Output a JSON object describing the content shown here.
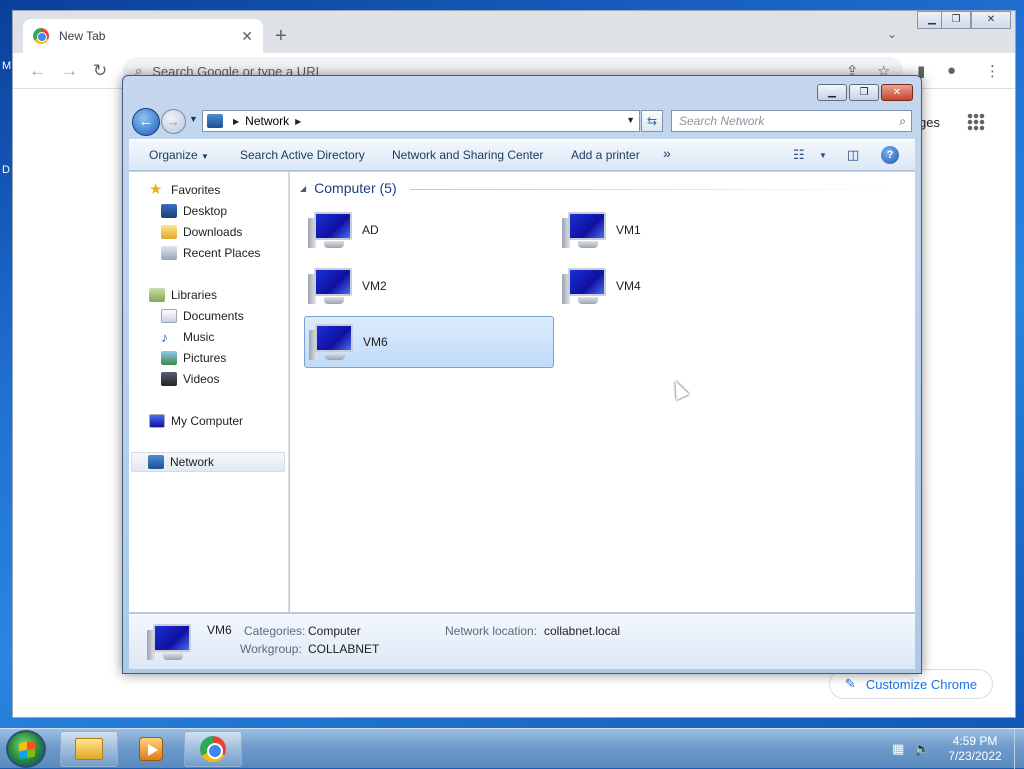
{
  "desktop": {
    "edge_letter_1": "M",
    "edge_letter_2": "D"
  },
  "chrome": {
    "tab_title": "New Tab",
    "tab_close": "✕",
    "new_tab": "+",
    "tab_menu": "⌄",
    "omnibox_placeholder": "Search Google or type a URL",
    "ntp_link": "ges",
    "customize_label": "Customize Chrome",
    "win_minimize": "▁",
    "win_restore": "❐",
    "win_close": "✕"
  },
  "explorer": {
    "address": {
      "location": "Network"
    },
    "search_placeholder": "Search Network",
    "commands": {
      "organize": "Organize",
      "search_ad": "Search Active Directory",
      "network_sharing": "Network and Sharing Center",
      "add_printer": "Add a printer",
      "more": "»"
    },
    "nav": {
      "favorites": "Favorites",
      "desktop": "Desktop",
      "downloads": "Downloads",
      "recent_places": "Recent Places",
      "libraries": "Libraries",
      "documents": "Documents",
      "music": "Music",
      "pictures": "Pictures",
      "videos": "Videos",
      "my_computer": "My Computer",
      "network": "Network"
    },
    "group_header": "Computer (5)",
    "computers": [
      "AD",
      "VM1",
      "VM2",
      "VM4",
      "VM6"
    ],
    "selected_computer": "VM6",
    "details": {
      "name": "VM6",
      "categories_label": "Categories:",
      "categories_value": "Computer",
      "workgroup_label": "Workgroup:",
      "workgroup_value": "COLLABNET",
      "network_location_label": "Network location:",
      "network_location_value": "collabnet.local"
    }
  },
  "taskbar": {
    "time": "4:59 PM",
    "date": "7/23/2022"
  },
  "colors": {
    "explorer_frame": "#c4d7ee",
    "selection": "#c1dbfa",
    "group_header": "#1e3f8a",
    "chrome_accent": "#1a73e8"
  }
}
